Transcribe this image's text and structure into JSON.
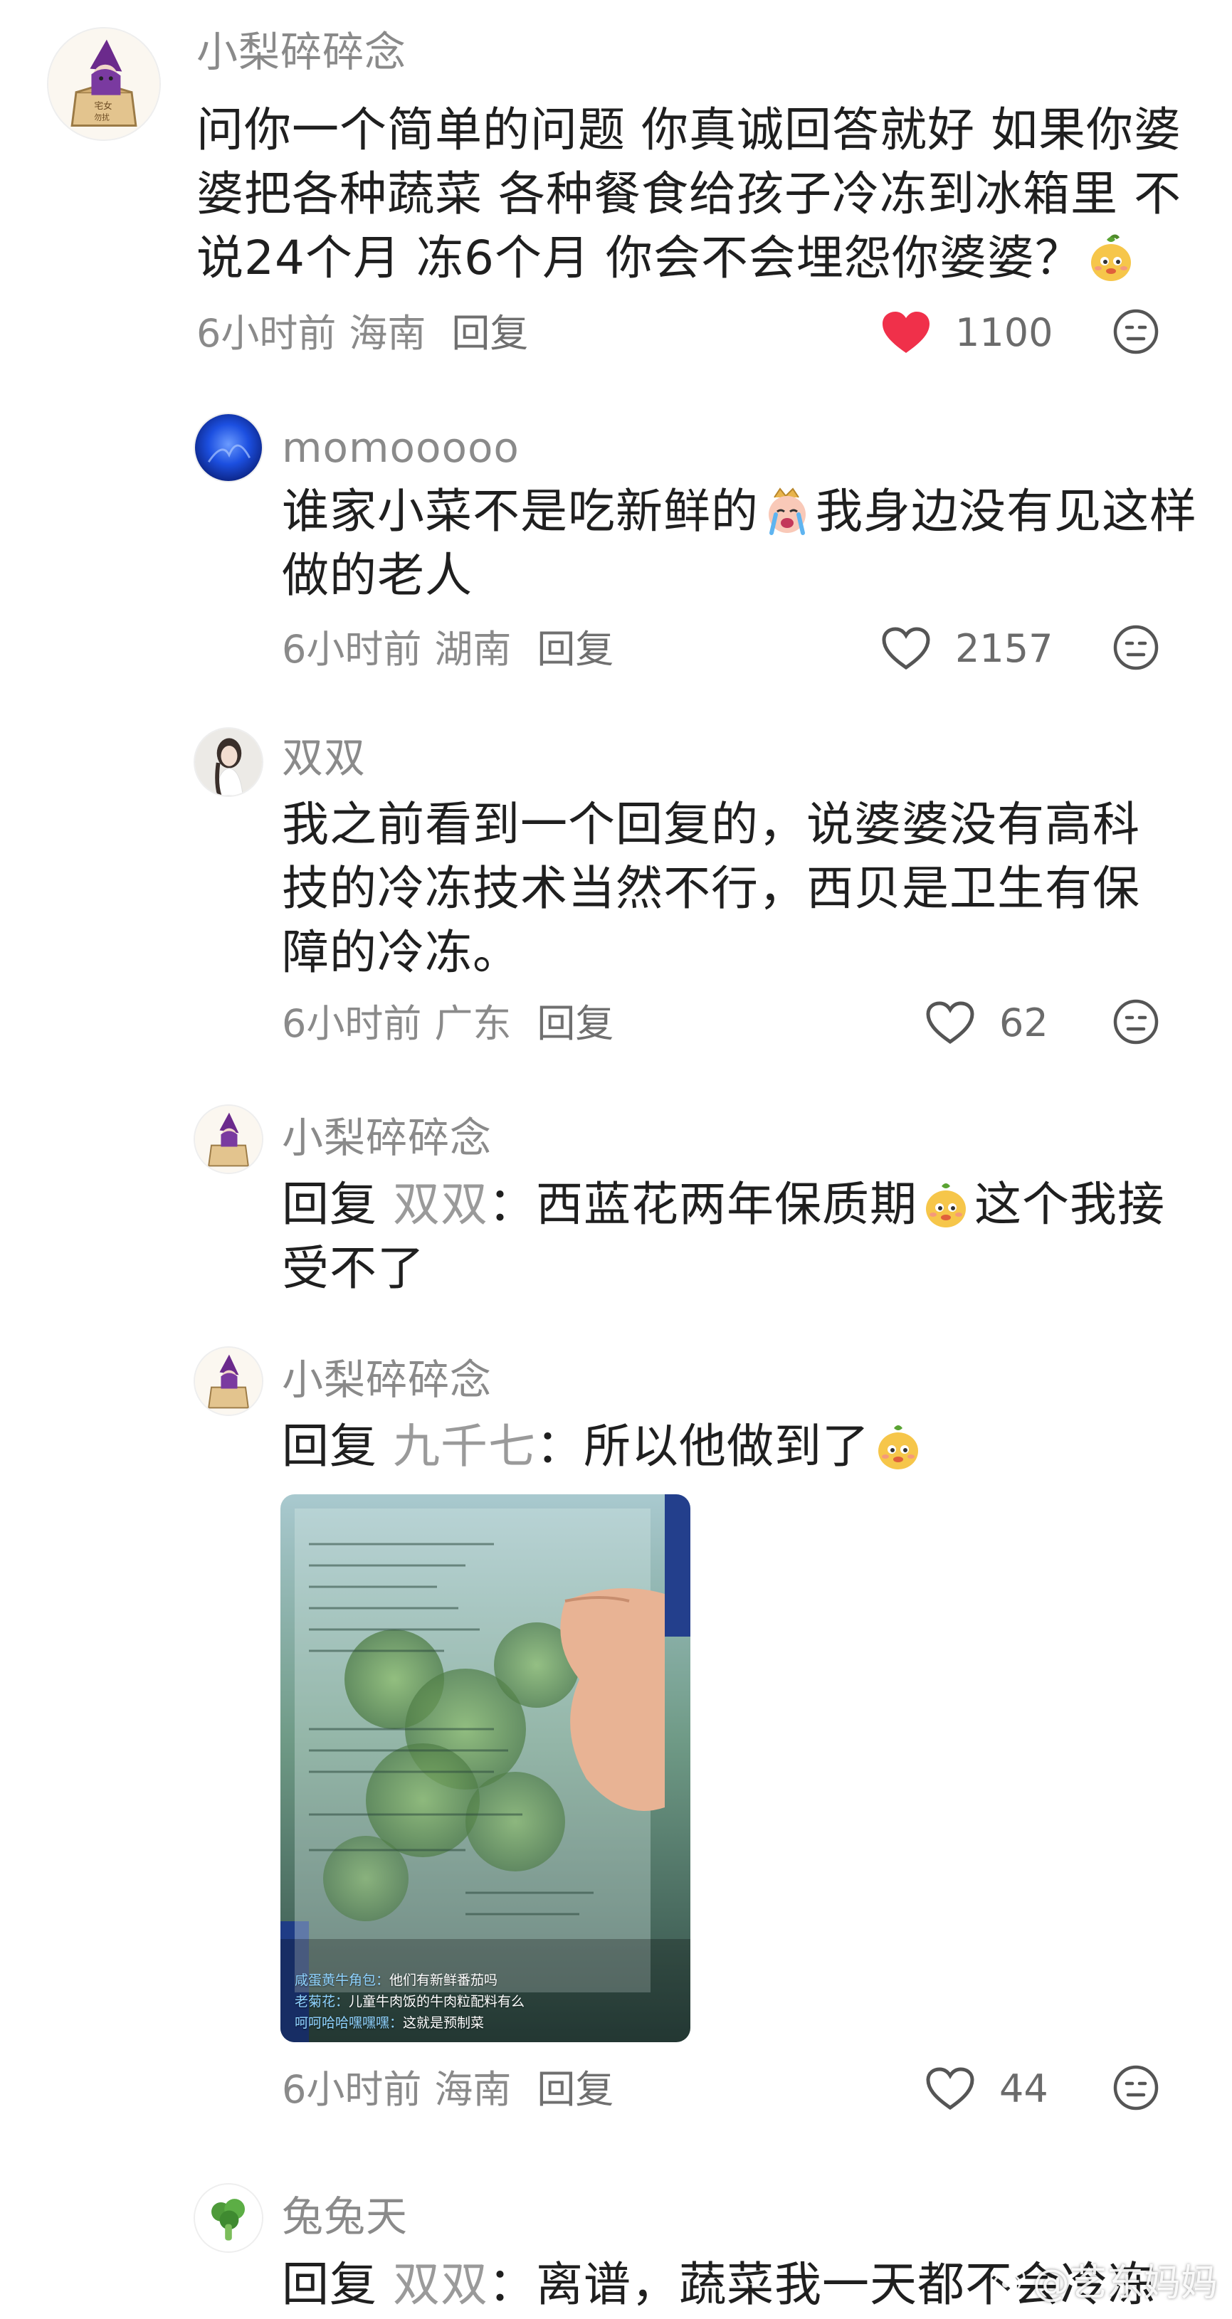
{
  "comments": [
    {
      "username": "小梨碎碎念",
      "text": "问你一个简单的问题 你真诚回答就好 如果你婆婆把各种蔬菜 各种餐食给孩子冷冻到冰箱里 不说24个月 冻6个月 你会不会埋怨你婆婆？",
      "time": "6小时前",
      "location": "海南",
      "reply_label": "回复",
      "likes": "1100",
      "liked": true
    },
    {
      "username": "momooooo",
      "text_a": "谁家小菜不是吃新鲜的",
      "text_b": "我身边没有见这样做的老人",
      "time": "6小时前",
      "location": "湖南",
      "reply_label": "回复",
      "likes": "2157",
      "liked": false
    },
    {
      "username": "双双",
      "text": "我之前看到一个回复的，说婆婆没有高科技的冷冻技术当然不行，西贝是卫生有保障的冷冻。",
      "time": "6小时前",
      "location": "广东",
      "reply_label": "回复",
      "likes": "62",
      "liked": false
    },
    {
      "username": "小梨碎碎念",
      "reply_prefix": "回复",
      "reply_to": "双双",
      "text_a": "：西蓝花两年保质期",
      "text_b": "这个我接受不了"
    },
    {
      "username": "小梨碎碎念",
      "reply_prefix": "回复",
      "reply_to": "九千七",
      "text": "：所以他做到了",
      "photo_captions": [
        {
          "who": "咸蛋黄牛角包：",
          "text": "他们有新鲜番茄吗"
        },
        {
          "who": "老菊花：",
          "text": "儿童牛肉饭的牛肉粒配料有么"
        },
        {
          "who": "呵呵哈哈嘿嘿嘿：",
          "text": "这就是预制菜"
        }
      ],
      "time": "6小时前",
      "location": "海南",
      "reply_label": "回复",
      "likes": "44",
      "liked": false
    },
    {
      "username": "兔兔天",
      "reply_prefix": "回复",
      "reply_to": "双双",
      "text": "：离谱，蔬菜我一天都不会冷冻"
    }
  ],
  "watermark": "@艺东妈妈",
  "colors": {
    "liked_heart": "#f0304a",
    "meta_gray": "#8a8a8a",
    "text": "#1f1f1f"
  },
  "icons": {
    "like": "heart-icon",
    "dislike": "neutral-face-icon",
    "emoji_pear": "pear-face-emoji",
    "emoji_cry": "crying-face-emoji"
  }
}
